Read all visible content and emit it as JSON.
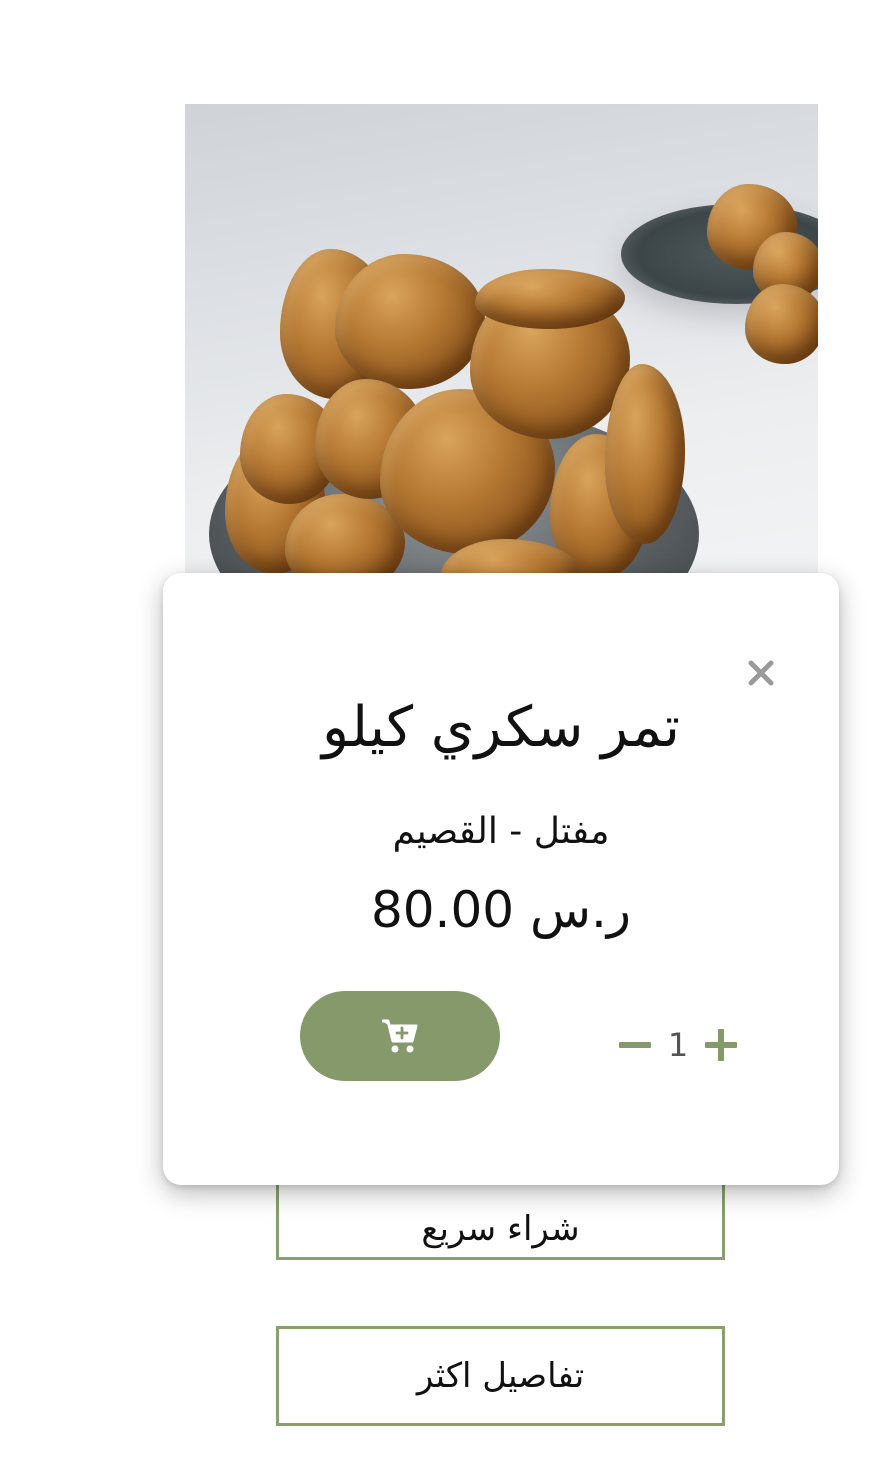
{
  "product": {
    "title": "تمر سكري كيلو",
    "subtitle": "مفتل - القصيم",
    "price": "80.00 ر.س",
    "image_icon": "dates-product-image"
  },
  "quantity": {
    "value": "1",
    "decrease_icon": "minus-icon",
    "increase_icon": "plus-icon"
  },
  "cart": {
    "icon": "cart-plus-icon"
  },
  "modal": {
    "close_icon": "close-icon"
  },
  "actions": {
    "quick_buy_label": "شراء سريع",
    "more_details_label": "تفاصيل اكثر"
  },
  "colors": {
    "accent": "#86996a",
    "button_border": "#88a06c",
    "close_icon": "#9a9a9a",
    "text": "#111111"
  }
}
